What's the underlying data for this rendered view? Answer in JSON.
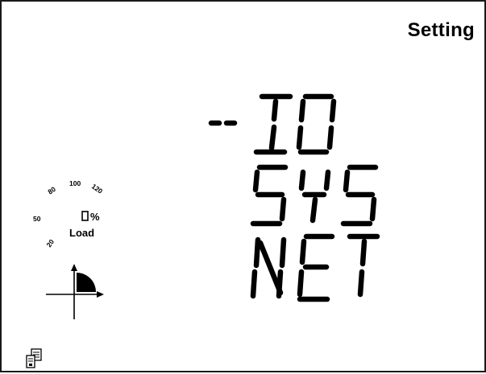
{
  "screen": {
    "mode_label": "Setting",
    "menu": {
      "cursor": "-",
      "items": [
        {
          "label": "IO",
          "selected": true
        },
        {
          "label": "SYS",
          "selected": false
        },
        {
          "label": "NET",
          "selected": false
        }
      ]
    },
    "load_gauge": {
      "ticks": [
        "20",
        "50",
        "80",
        "100",
        "120"
      ],
      "unit": "%",
      "caption": "Load"
    },
    "quadrant_indicator": {
      "active_quadrant": "I"
    },
    "status_icons": [
      "communication-device-icon"
    ]
  }
}
